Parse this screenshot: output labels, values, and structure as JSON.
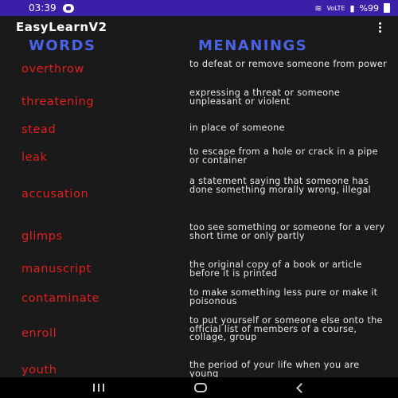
{
  "status_bar": {
    "time": "03:39",
    "network": "VoLTE",
    "battery": "%99"
  },
  "app_bar": {
    "title": "EasyLearnV2"
  },
  "headers": {
    "words": "WORDS",
    "meanings": "MENANINGS"
  },
  "entries": [
    {
      "word": "overthrow",
      "meaning": "to defeat or remove someone from power"
    },
    {
      "word": "threatening",
      "meaning": "expressing a threat or someone unpleasant or violent"
    },
    {
      "word": "stead",
      "meaning": "in place of someone"
    },
    {
      "word": "leak",
      "meaning": "to escape from a hole or crack in a pipe or container"
    },
    {
      "word": "accusation",
      "meaning": "a statement saying that someone has done something morally wrong, illegal"
    },
    {
      "word": "glimps",
      "meaning": "too see something or someone for a very short time or only partly"
    },
    {
      "word": "manuscript",
      "meaning": "the original copy of a book or article before it is printed"
    },
    {
      "word": "contaminate",
      "meaning": "to make something less pure or make it poisonous"
    },
    {
      "word": "enroll",
      "meaning": "to put yourself or someone else onto the official list of members of a course, collage, group"
    },
    {
      "word": "youth",
      "meaning": "the period of your life when you are young"
    }
  ],
  "colors": {
    "accent_header": "#4a62e8",
    "word": "#e41f1f",
    "status_bar": "#3a1fa8"
  }
}
